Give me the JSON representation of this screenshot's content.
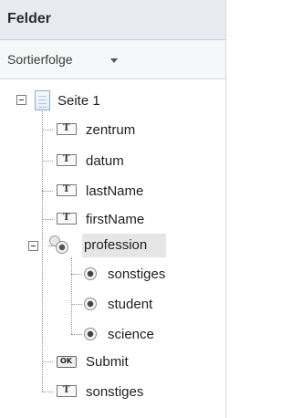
{
  "panel": {
    "title": "Felder",
    "sort_label": "Sortierfolge"
  },
  "tree": {
    "page": {
      "label": "Seite 1"
    },
    "items": [
      {
        "label": "zentrum",
        "type": "text-field"
      },
      {
        "label": "datum",
        "type": "text-field"
      },
      {
        "label": "lastName",
        "type": "text-field"
      },
      {
        "label": "firstName",
        "type": "text-field"
      },
      {
        "label": "profession",
        "type": "radio-group",
        "selected": true,
        "children": [
          {
            "label": "sonstiges",
            "type": "radio-button"
          },
          {
            "label": "student",
            "type": "radio-button"
          },
          {
            "label": "science",
            "type": "radio-button"
          }
        ]
      },
      {
        "label": "Submit",
        "type": "button"
      },
      {
        "label": "sonstiges",
        "type": "text-field"
      }
    ]
  },
  "icons": {
    "page": "page-icon",
    "text_field": "text-field-icon",
    "radio_group": "radio-group-icon",
    "radio_button": "radio-button-icon",
    "button": "button-icon",
    "button_glyph": "OK",
    "text_glyph": "T"
  },
  "colors": {
    "header_bg": "#e8ecf1",
    "selection_bg": "#e6e6e6"
  }
}
